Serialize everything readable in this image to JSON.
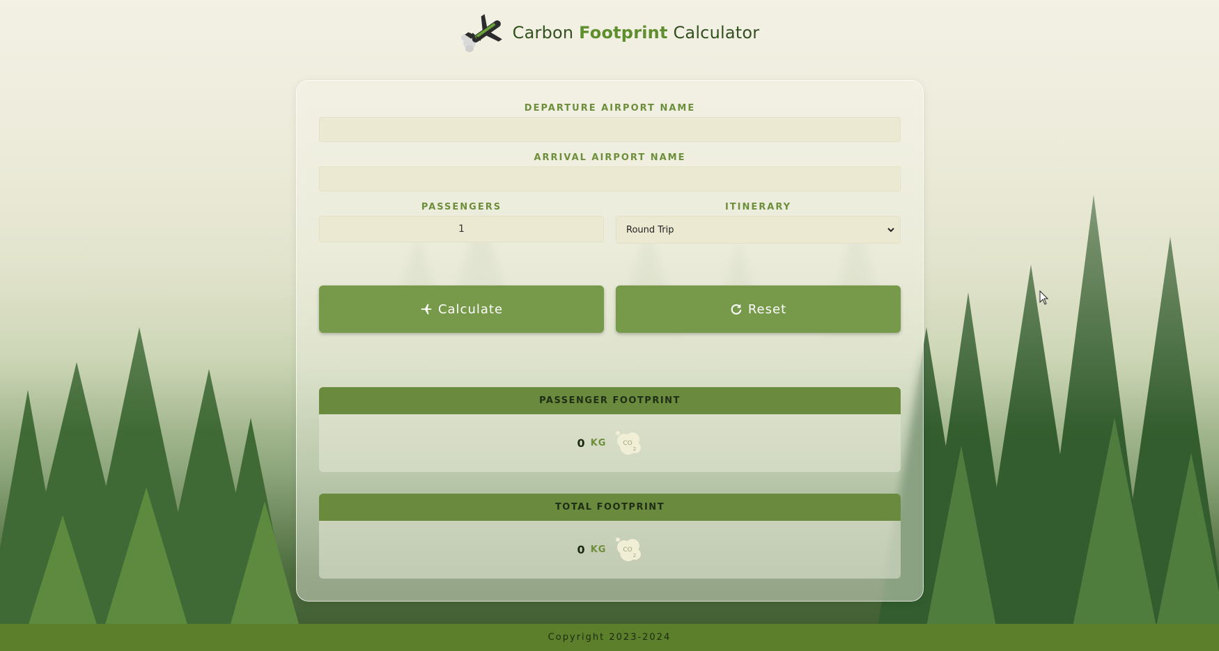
{
  "header": {
    "title_part1": "Carbon ",
    "title_part2": "Footprint",
    "title_part3": " Calculator",
    "logo_icon": "airplane-smoke-icon"
  },
  "form": {
    "departure_label": "DEPARTURE AIRPORT NAME",
    "departure_value": "",
    "arrival_label": "ARRIVAL AIRPORT NAME",
    "arrival_value": "",
    "passengers_label": "PASSENGERS",
    "passengers_value": "1",
    "itinerary_label": "ITINERARY",
    "itinerary_selected": "Round Trip"
  },
  "buttons": {
    "calculate_label": "Calculate",
    "calculate_icon": "plane-icon",
    "reset_label": "Reset",
    "reset_icon": "refresh-icon"
  },
  "results": {
    "passenger_title": "PASSENGER FOOTPRINT",
    "passenger_value": "0",
    "passenger_unit": "KG",
    "total_title": "TOTAL FOOTPRINT",
    "total_value": "0",
    "total_unit": "KG",
    "co2_icon": "co2-cloud-icon"
  },
  "footer": {
    "copyright": "Copyright 2023-2024"
  },
  "colors": {
    "accent": "#77994a",
    "header_bar": "#6a8a3e",
    "footer": "#5b7f2b",
    "label": "#6d8e3b"
  }
}
